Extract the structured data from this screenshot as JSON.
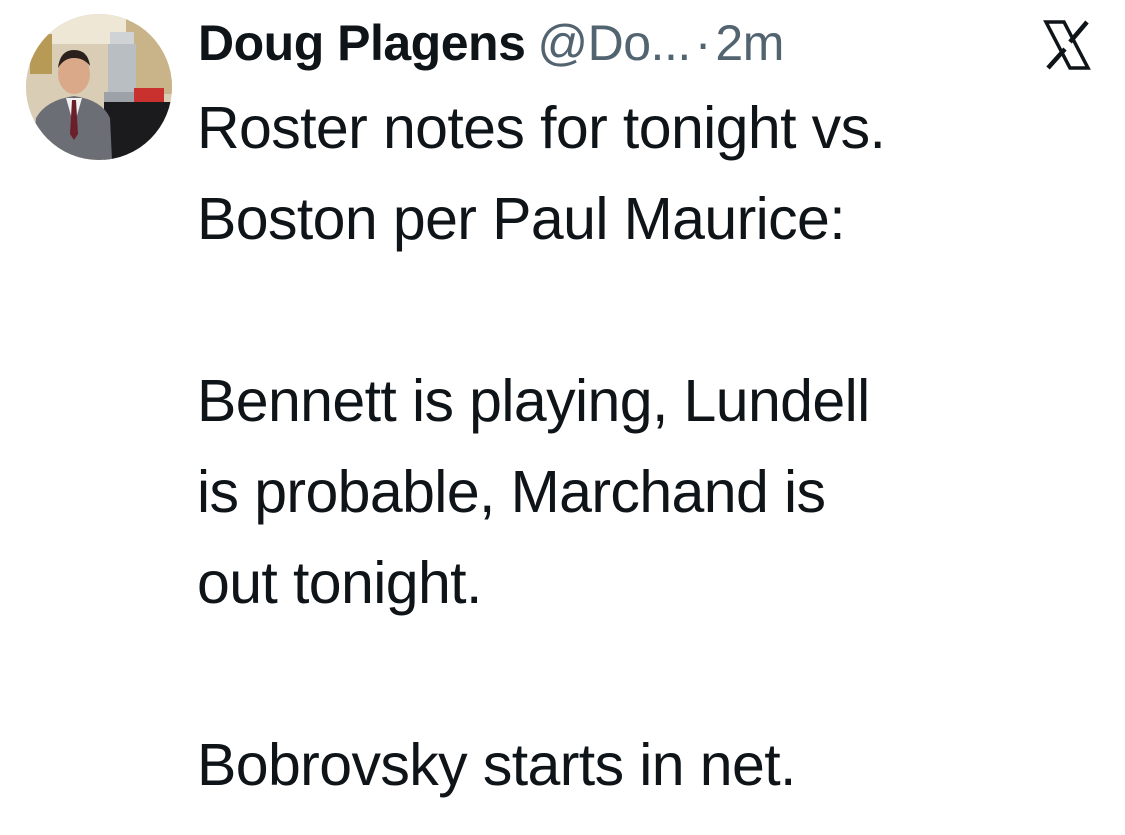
{
  "tweet": {
    "author": {
      "display_name": "Doug Plagens",
      "handle": "@Do...",
      "avatar_icon": "profile-photo"
    },
    "separator": "·",
    "timestamp": "2m",
    "close_icon": "x-close-icon",
    "body": {
      "line1": "Roster notes for tonight vs.",
      "line2": "Boston per Paul Maurice:",
      "line3": "Bennett is playing, Lundell",
      "line4": "is probable, Marchand is",
      "line5": "out tonight.",
      "line6": "Bobrovsky starts in net."
    }
  },
  "colors": {
    "text_primary": "#0f1419",
    "text_secondary": "#536471",
    "background": "#ffffff"
  }
}
